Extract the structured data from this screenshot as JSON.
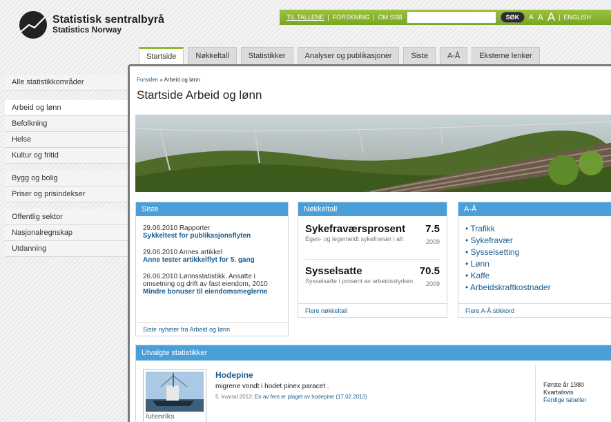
{
  "logo": {
    "line1": "Statistisk sentralbyrå",
    "line2": "Statistics Norway"
  },
  "topbar": {
    "links": [
      "TIL TALLENE",
      "FORSKNING",
      "OM SSB"
    ],
    "search_placeholder": "",
    "search_button": "SØK",
    "font_sizes": [
      "A",
      "A",
      "A"
    ],
    "english": "ENGLISH",
    "sep": "|"
  },
  "tabs": [
    "Startside",
    "Nøkkeltall",
    "Statistikker",
    "Analyser og publikasjoner",
    "Siste",
    "A-Å",
    "Eksterne lenker"
  ],
  "sidebar": {
    "group1": [
      "Alle statistikkområder"
    ],
    "group2": [
      "Arbeid og lønn",
      "Befolkning",
      "Helse",
      "Kultur og fritid"
    ],
    "group3": [
      "Bygg og bolig",
      "Priser og prisindekser"
    ],
    "group4": [
      "Offentlig sektor",
      "Nasjonalregnskap",
      "Utdanning"
    ]
  },
  "breadcrumb": {
    "home": "Forsiden",
    "sep": "»",
    "current": "Arbeid og lønn"
  },
  "page_title": "Startside Arbeid og lønn",
  "siste": {
    "heading": "Siste",
    "items": [
      {
        "meta": "29.06.2010 Rapporter",
        "title": "Sykkeltest for publikasjonsflyten"
      },
      {
        "meta": "29.06.2010 Annes artikkel",
        "title": "Anne tester artikkelflyt for 5. gang"
      },
      {
        "meta": "26.06.2010 Lønnsstatistikk. Ansatte i omsetning og drift av fast eiendom, 2010",
        "title": "Mindre bonuser til eiendomsmeglerne"
      }
    ],
    "footer": "Siste nyheter fra Arbeid og lønn"
  },
  "nokkeltall": {
    "heading": "Nøkkeltall",
    "items": [
      {
        "name": "Sykefraværsprosent",
        "value": "7.5",
        "desc": "Egen- og legemeldt sykefravær i alt",
        "year": "2009"
      },
      {
        "name": "Sysselsatte",
        "value": "70.5",
        "desc": "Sysselsatte i prosent av arbeidsstyrken",
        "year": "2009"
      }
    ],
    "footer": "Flere nøkkeltall"
  },
  "aa": {
    "heading": "A-Å",
    "items": [
      "Trafikk",
      "Sykefravær",
      "Sysselsetting",
      "Lønn",
      "Kaffe",
      "Arbeidskraftkostnader"
    ],
    "footer": "Flere A-Å stikkord"
  },
  "utvalgte": {
    "heading": "Utvalgte statistikker",
    "thumb_caption": "/utenriks",
    "title": "Hodepine",
    "text": "migrene vondt i hodet pinex paracet .",
    "meta_prefix": "5. kvartal 2013:",
    "meta_link": "En av fem er plaget av hodepine (17.02.2013)",
    "side": [
      "Første år 1980",
      "Kvartalsvis"
    ],
    "side_link": "Ferdige tabeller"
  }
}
